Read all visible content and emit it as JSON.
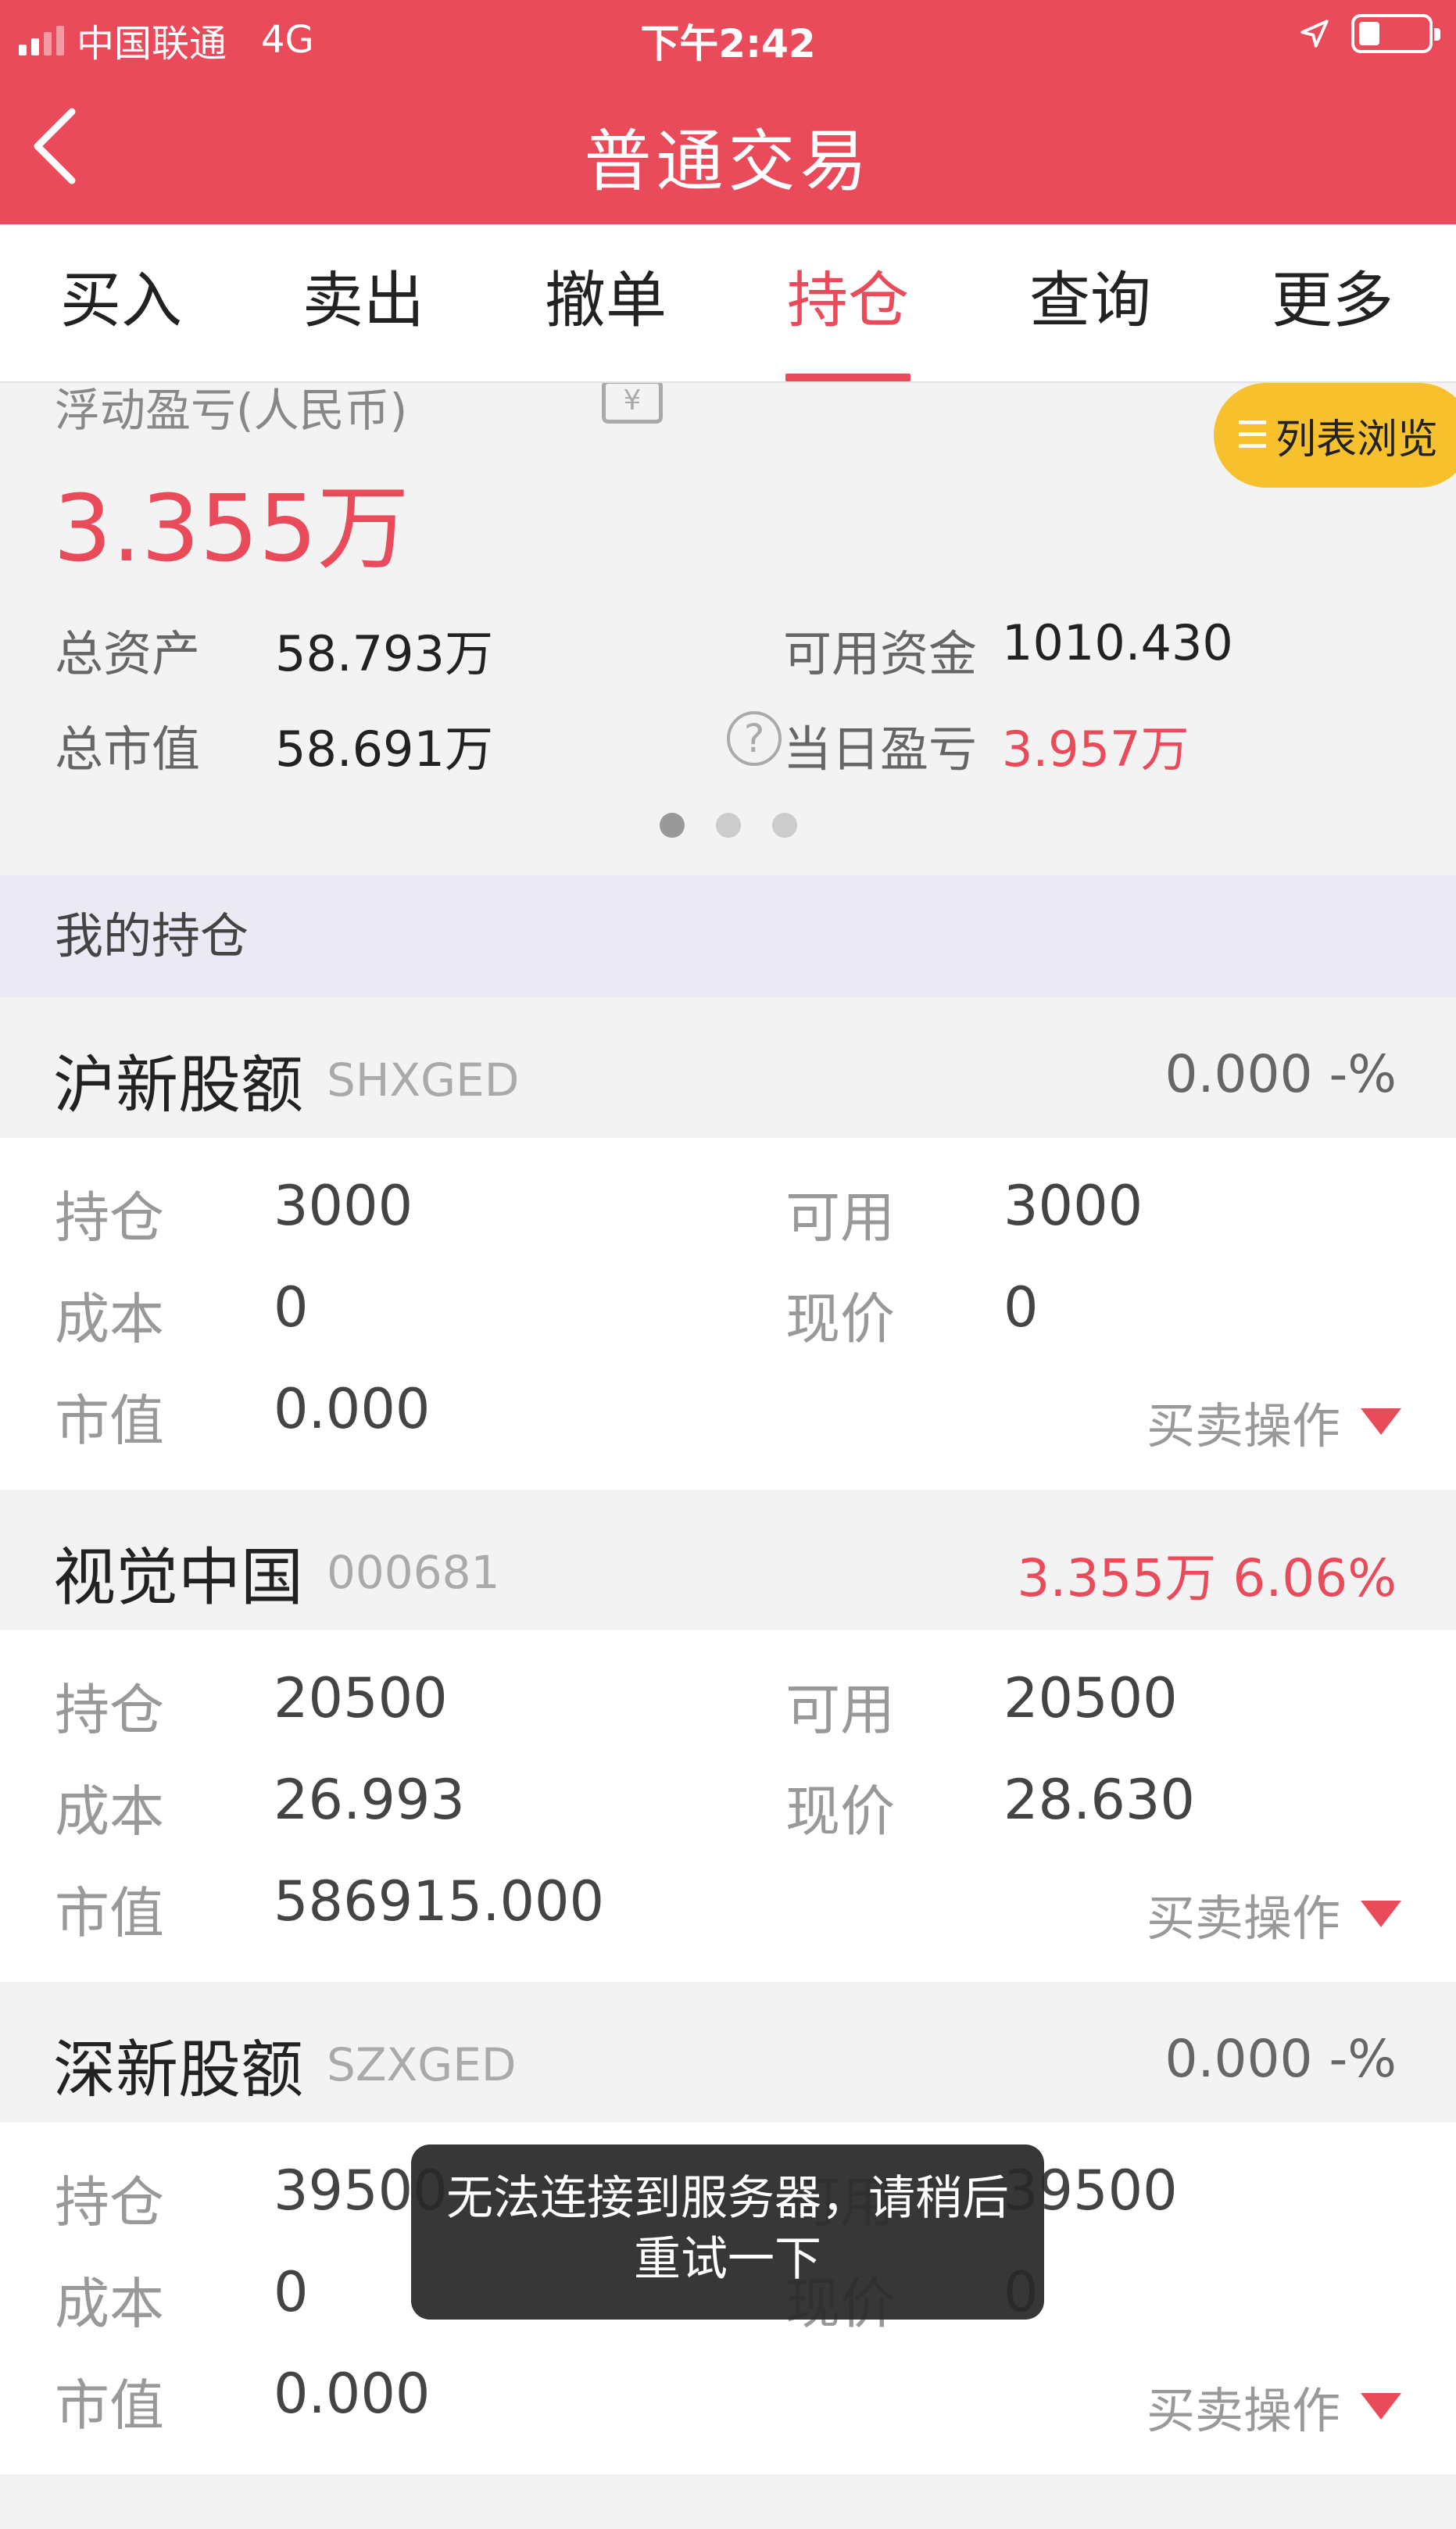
{
  "status_bar": {
    "carrier": "中国联通",
    "network": "4G",
    "time": "下午2:42"
  },
  "nav": {
    "title": "普通交易",
    "back_icon": "chevron-left-icon"
  },
  "tabs": [
    {
      "label": "买入",
      "active": false
    },
    {
      "label": "卖出",
      "active": false
    },
    {
      "label": "撤单",
      "active": false
    },
    {
      "label": "持仓",
      "active": true
    },
    {
      "label": "查询",
      "active": false
    },
    {
      "label": "更多",
      "active": false
    }
  ],
  "summary": {
    "float_label": "浮动盈亏(人民币)",
    "float_value": "3.355万",
    "list_view_label": "列表浏览",
    "total_assets_label": "总资产",
    "total_assets_value": "58.793万",
    "available_funds_label": "可用资金",
    "available_funds_value": "1010.430",
    "total_market_value_label": "总市值",
    "total_market_value_value": "58.691万",
    "daily_pl_label": "当日盈亏",
    "daily_pl_value": "3.957万",
    "page_dots": 3,
    "active_dot": 0
  },
  "holdings": {
    "section_title": "我的持仓",
    "labels": {
      "position": "持仓",
      "available": "可用",
      "cost": "成本",
      "price": "现价",
      "market_value": "市值",
      "trade_op": "买卖操作"
    },
    "items": [
      {
        "name": "沪新股额",
        "code": "SHXGED",
        "change": "0.000  -%",
        "position": "3000",
        "available": "3000",
        "cost": "0",
        "price": "0",
        "market_value": "0.000"
      },
      {
        "name": "视觉中国",
        "code": "000681",
        "change": "3.355万  6.06%",
        "position": "20500",
        "available": "20500",
        "cost": "26.993",
        "price": "28.630",
        "market_value": "586915.000"
      },
      {
        "name": "深新股额",
        "code": "SZXGED",
        "change": "0.000  -%",
        "position": "39500",
        "available": "39500",
        "cost": "0",
        "price": "0",
        "market_value": "0.000"
      }
    ]
  },
  "toast": {
    "line1": "无法连接到服务器，请稍后",
    "line2": "重试一下"
  },
  "colors": {
    "brand_red": "#ea4b5b",
    "list_view_yellow": "#f7c12e"
  }
}
